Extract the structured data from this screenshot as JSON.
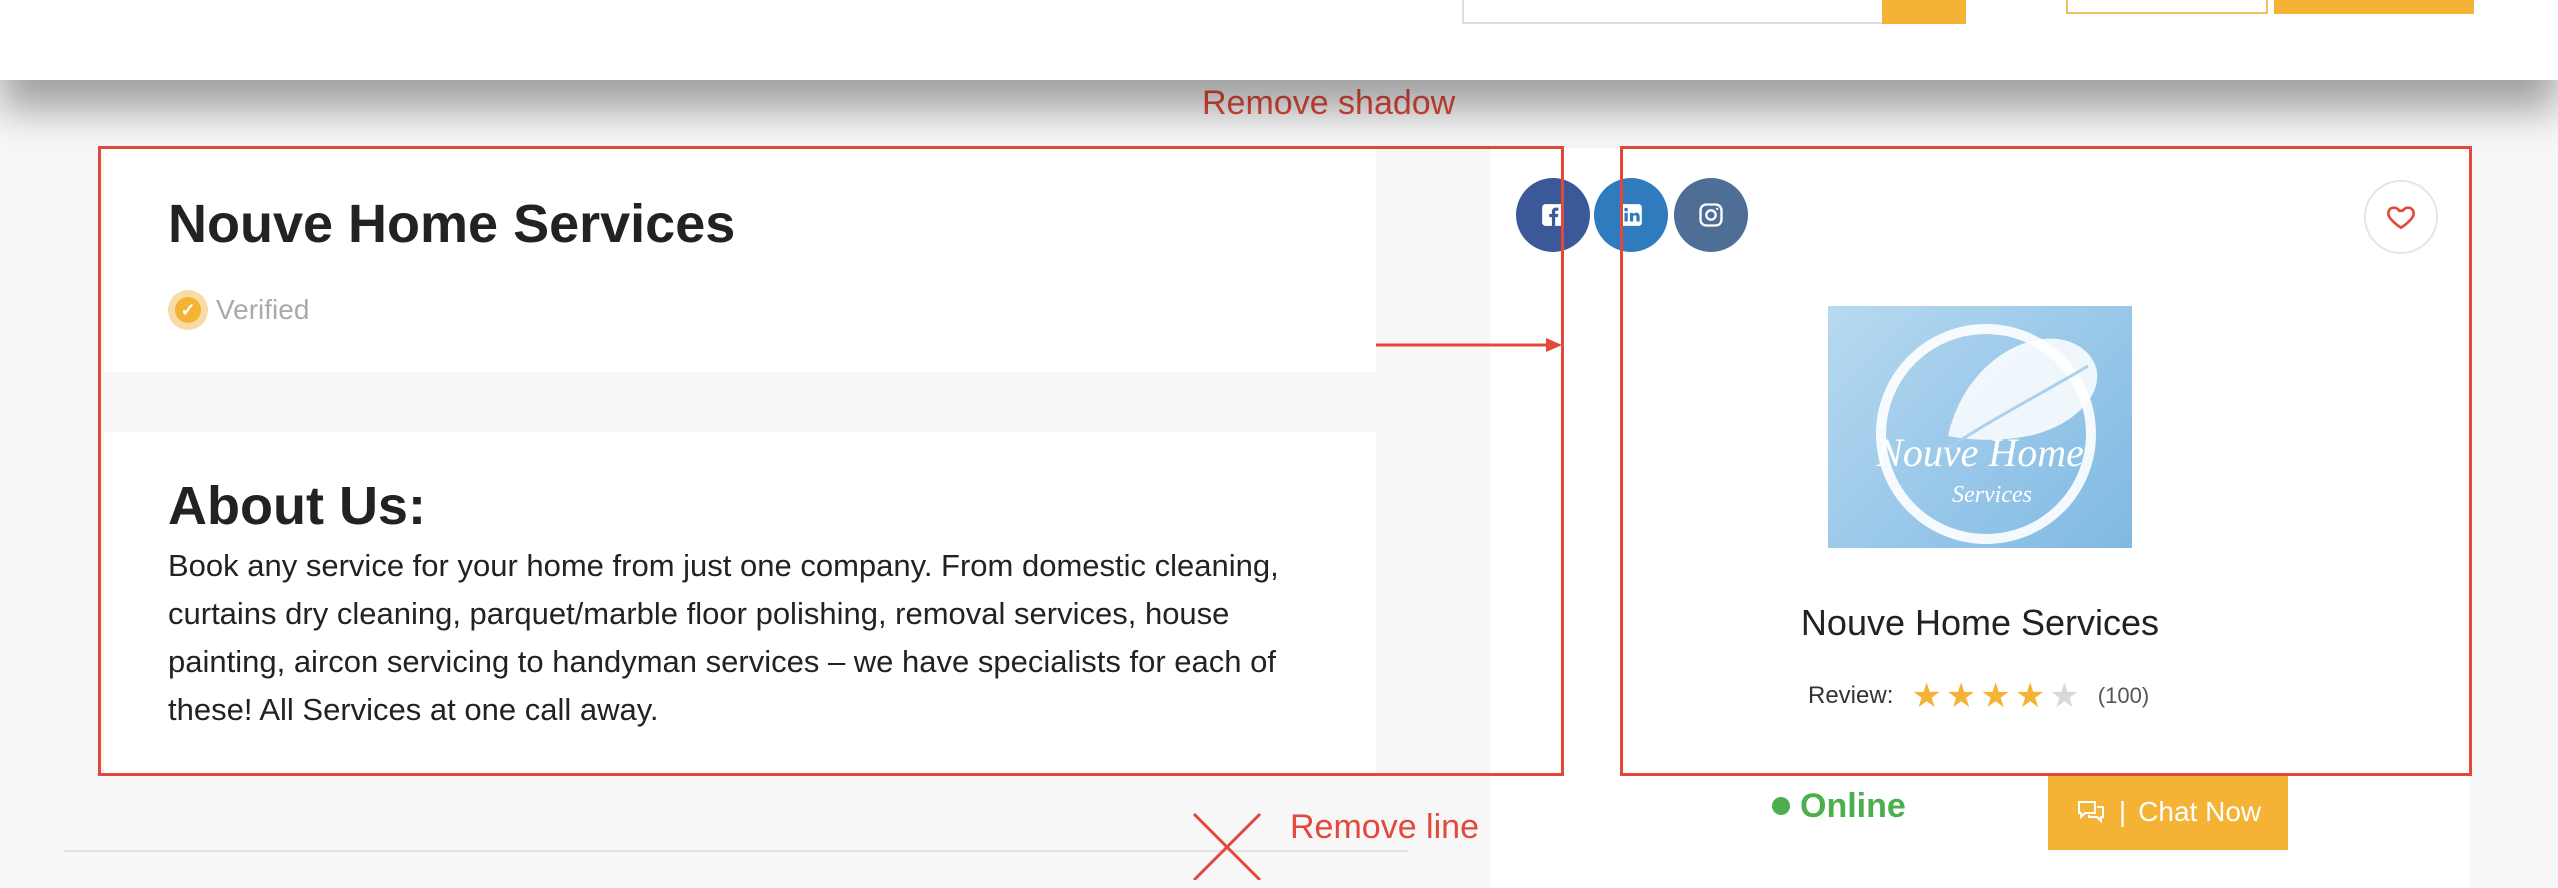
{
  "header": {},
  "profile": {
    "company_name": "Nouve Home Services",
    "verified_label": "Verified"
  },
  "about": {
    "title": "About Us:",
    "text": "Book any service for your home from just one company. From domestic cleaning, curtains dry cleaning, parquet/marble floor polishing, removal services, house painting, aircon servicing to handyman services – we have specialists for each of these! All Services at one call away."
  },
  "sidebar_card": {
    "social": [
      {
        "name": "facebook-icon",
        "color": "#3b5998"
      },
      {
        "name": "linkedin-icon",
        "color": "#2f7bbd"
      },
      {
        "name": "instagram-icon",
        "color": "#4e6e96"
      }
    ],
    "favorite_icon": "heart-icon",
    "logo_text": "Nouve Home",
    "logo_subtext": "Services",
    "name": "Nouve Home Services",
    "review_label": "Review:",
    "rating": 4,
    "rating_max": 5,
    "review_count": "(100)",
    "status": "Online",
    "chat_label": "Chat Now"
  },
  "annotations": {
    "remove_shadow": "Remove shadow",
    "remove_line": "Remove line"
  },
  "colors": {
    "accent": "#f5b335",
    "annotation": "#e2493b",
    "online": "#4cae4c"
  }
}
